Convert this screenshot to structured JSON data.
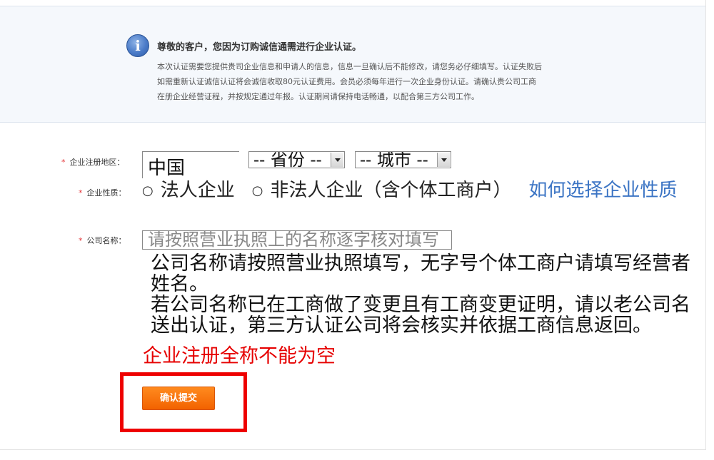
{
  "notice": {
    "icon": "info-icon",
    "title": "尊敬的客户，您因为订购诚信通需进行企业认证。",
    "lines": [
      "本次认证需要您提供贵司企业信息和申请人的信息，信息一旦确认后不能修改，请您务必仔细填写。认证失败后",
      "如需重新认证诚信认证将会诚信收取80元认证费用。会员必须每年进行一次企业身份认证。请确认贵公司工商",
      "在册企业经营证程，并按规定通过年报。认证期间请保持电话畅通，以配合第三方公司工作。"
    ]
  },
  "form": {
    "required_mark": "*",
    "region": {
      "label": "企业注册地区：",
      "country_value": "中国",
      "province_value": "-- 省份 --",
      "city_value": "-- 城市 --"
    },
    "nature": {
      "label": "企业性质：",
      "options": [
        "法人企业",
        "非法人企业（含个体工商户）"
      ],
      "help_link": "如何选择企业性质"
    },
    "company_name": {
      "label": "公司名称：",
      "placeholder": "请按照营业执照上的名称逐字核对填写",
      "hints": [
        "公司名称请按照营业执照填写，无字号个体工商户请填写经营者姓名。",
        "若公司名称已在工商做了变更且有工商变更证明，请以老公司名送出认证，第三方认证公司将会核实并依据工商信息返回。"
      ],
      "error": "企业注册全称不能为空"
    },
    "submit_label": "确认提交"
  },
  "colors": {
    "accent_orange": "#f26200",
    "error_red": "#e60000",
    "link_blue": "#3b74c4",
    "highlight_red": "#ee0000"
  }
}
